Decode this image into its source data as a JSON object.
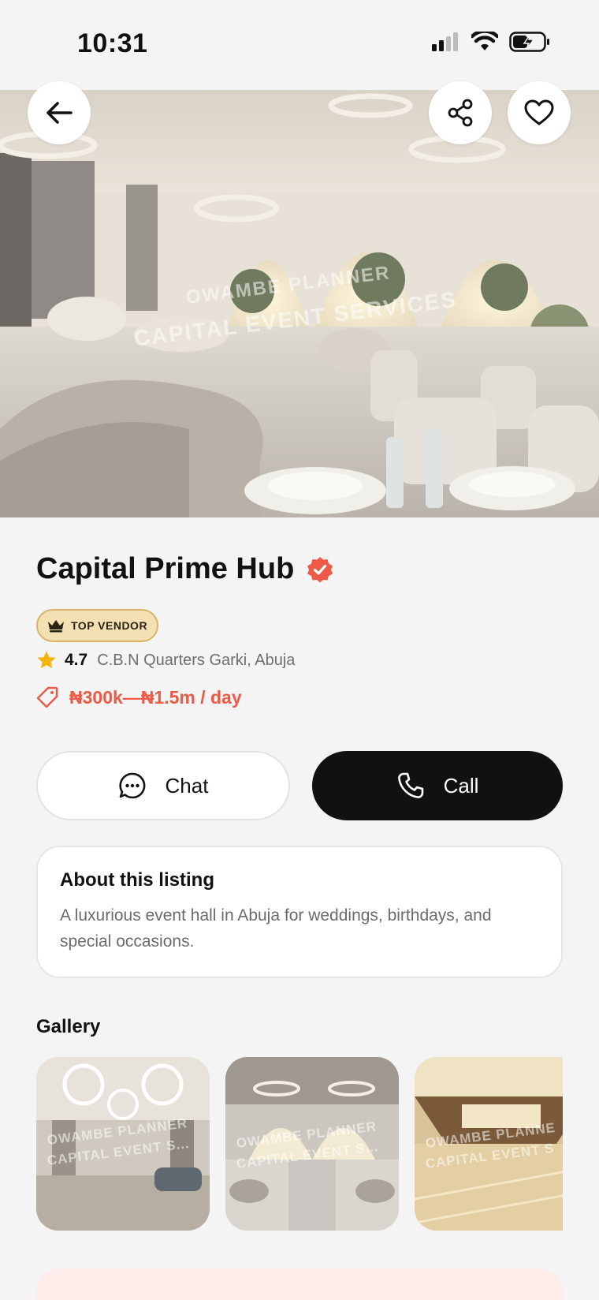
{
  "status_bar": {
    "time": "10:31"
  },
  "hero": {
    "watermark_line1": "OWAMBE PLANNER",
    "watermark_line2": "CAPITAL EVENT SERVICES"
  },
  "listing": {
    "name": "Capital Prime Hub",
    "badge": "TOP VENDOR",
    "rating": "4.7",
    "location": "C.B.N Quarters Garki, Abuja",
    "price": "₦300k—₦1.5m / day"
  },
  "actions": {
    "chat_label": "Chat",
    "call_label": "Call"
  },
  "about": {
    "title": "About this listing",
    "text": "A luxurious event hall in Abuja for weddings, birthdays, and special occasions."
  },
  "gallery": {
    "title": "Gallery",
    "items": [
      {
        "watermark_line1": "OWAMBE PLANNER",
        "watermark_line2": "CAPITAL EVENT S..."
      },
      {
        "watermark_line1": "OWAMBE PLANNER",
        "watermark_line2": "CAPITAL EVENT S..."
      },
      {
        "watermark_line1": "OWAMBE PLANNE",
        "watermark_line2": "CAPITAL EVENT S"
      }
    ]
  },
  "colors": {
    "accent": "#ee5a47",
    "badge_bg": "#f3e1b4",
    "star": "#f5b400",
    "call_bg": "#111111"
  },
  "icons": [
    "back-arrow-icon",
    "share-icon",
    "heart-icon",
    "verified-icon",
    "crown-icon",
    "star-icon",
    "price-tag-icon",
    "chat-bubble-icon",
    "phone-icon"
  ]
}
